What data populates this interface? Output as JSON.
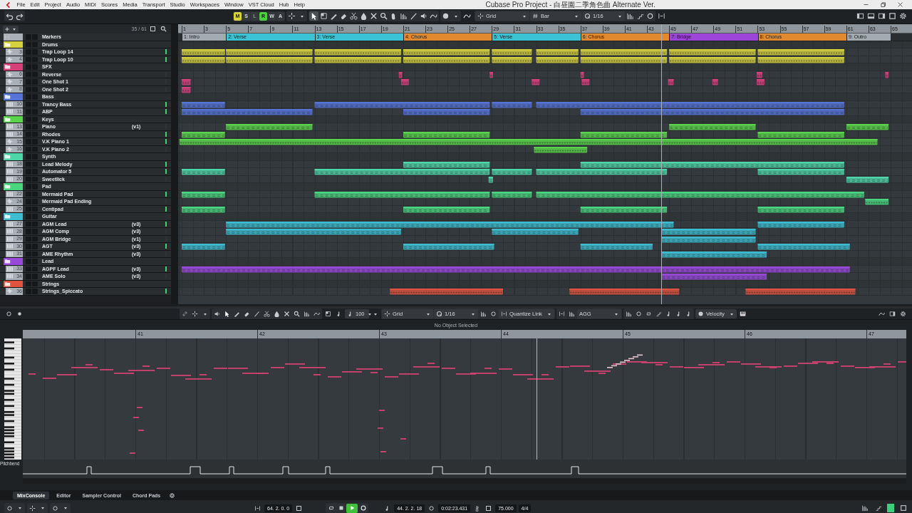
{
  "menu": [
    "File",
    "Edit",
    "Project",
    "Audio",
    "MIDI",
    "Scores",
    "Media",
    "Transport",
    "Studio",
    "Workspaces",
    "Window",
    "VST Cloud",
    "Hub",
    "Help"
  ],
  "window": {
    "title": "Cubase Pro Project - 白昼園二季角色曲 Alternate Ver."
  },
  "toolbar": {
    "modes": [
      {
        "label": "M",
        "kind": "mute",
        "on": true,
        "disabled": false
      },
      {
        "label": "S",
        "kind": "solo",
        "on": false,
        "disabled": false
      },
      {
        "label": "L",
        "kind": "listen",
        "on": false,
        "disabled": true
      },
      {
        "label": "R",
        "kind": "read",
        "on": true,
        "disabled": false
      },
      {
        "label": "W",
        "kind": "write",
        "on": false,
        "disabled": false
      },
      {
        "label": "A",
        "kind": "auto",
        "on": false,
        "disabled": false
      }
    ],
    "snap_type": "Grid",
    "grid_type": "Bar",
    "quantize": "1/16"
  },
  "project": {
    "track_count": "35 / 61",
    "marker_track": "Markers",
    "ruler": [
      "1",
      "3",
      "5",
      "7",
      "9",
      "11",
      "13",
      "15",
      "17",
      "19",
      "21",
      "23",
      "25",
      "27",
      "29",
      "31",
      "33",
      "35",
      "37",
      "39",
      "41",
      "43",
      "45",
      "47",
      "49",
      "51",
      "53",
      "55",
      "57",
      "59",
      "61",
      "63",
      "65"
    ],
    "markers": [
      {
        "label": "1: Intro",
        "color": "#a3abb2"
      },
      {
        "label": "2: Verse",
        "color": "#3cc3d3"
      },
      {
        "label": "3: Verse",
        "color": "#3cc3d3"
      },
      {
        "label": "4: Chorus",
        "color": "#e0892f"
      },
      {
        "label": "5: Verse",
        "color": "#3cc3d3"
      },
      {
        "label": "6: Chorus",
        "color": "#e0892f"
      },
      {
        "label": "7: Bridge",
        "color": "#9b46d8"
      },
      {
        "label": "8: Chorus",
        "color": "#e0892f"
      },
      {
        "label": "9: Outro",
        "color": "#a3abb2"
      }
    ],
    "folders": [
      {
        "name": "Drums",
        "color": "#d6d23e",
        "children": [
          {
            "name": "Trap Loop 14",
            "kind": "audio",
            "number": "3",
            "signal": true
          },
          {
            "name": "Trap Loop 10",
            "kind": "audio",
            "number": "4",
            "signal": true
          }
        ]
      },
      {
        "name": "SFX",
        "color": "#d8407a",
        "children": [
          {
            "name": "Reverse",
            "kind": "audio",
            "number": "6",
            "signal": false
          },
          {
            "name": "One Shot 1",
            "kind": "audio",
            "number": "7",
            "signal": false
          },
          {
            "name": "One Shot 2",
            "kind": "audio",
            "number": "8",
            "signal": false
          }
        ]
      },
      {
        "name": "Bass",
        "color": "#5673d8",
        "children": [
          {
            "name": "Trancy Bass",
            "kind": "instrument",
            "number": "10",
            "signal": true
          },
          {
            "name": "ABP",
            "kind": "instrument",
            "number": "11",
            "signal": true
          }
        ]
      },
      {
        "name": "Keys",
        "color": "#5ad44a",
        "children": [
          {
            "name": "Piano",
            "kind": "instrument",
            "number": "13",
            "version": "(v1)",
            "signal": false
          },
          {
            "name": "Rhodes",
            "kind": "instrument",
            "number": "14",
            "signal": true
          },
          {
            "name": "V.K Piano 1",
            "kind": "audio",
            "number": "15",
            "signal": true
          },
          {
            "name": "V.K Piano 2",
            "kind": "audio",
            "number": "16",
            "signal": false
          }
        ]
      },
      {
        "name": "Synth",
        "color": "#4ed6a8",
        "children": [
          {
            "name": "Lead Melody",
            "kind": "instrument",
            "number": "18",
            "signal": true
          },
          {
            "name": "Automator 5",
            "kind": "instrument",
            "number": "19",
            "signal": true
          },
          {
            "name": "Sweetlick",
            "kind": "instrument",
            "number": "20",
            "signal": false
          }
        ]
      },
      {
        "name": "Pad",
        "color": "#48d67e",
        "children": [
          {
            "name": "Mermaid Pad",
            "kind": "instrument",
            "number": "22",
            "signal": true
          },
          {
            "name": "Mermaid Pad Ending",
            "kind": "audio",
            "number": "24",
            "signal": false
          },
          {
            "name": "Centipad",
            "kind": "instrument",
            "number": "25",
            "signal": true
          }
        ]
      },
      {
        "name": "Guitar",
        "color": "#3cbdd0",
        "children": [
          {
            "name": "AGM Lead",
            "kind": "instrument",
            "number": "27",
            "version": "(v3)",
            "signal": true
          },
          {
            "name": "AGM Comp",
            "kind": "instrument",
            "number": "28",
            "version": "(v3)",
            "signal": false
          },
          {
            "name": "AGM Bridge",
            "kind": "instrument",
            "number": "29",
            "version": "(v1)",
            "signal": false
          },
          {
            "name": "AGT",
            "kind": "instrument",
            "number": "30",
            "version": "(v3)",
            "signal": true
          },
          {
            "name": "AME Rhythm",
            "kind": "instrument",
            "number": "31",
            "version": "(v3)",
            "signal": false
          }
        ]
      },
      {
        "name": "Lead",
        "color": "#9a48dc",
        "children": [
          {
            "name": "AGPF Lead",
            "kind": "instrument",
            "number": "33",
            "version": "(v3)",
            "signal": true
          },
          {
            "name": "AME Solo",
            "kind": "instrument",
            "number": "34",
            "version": "(v3)",
            "signal": false
          }
        ]
      },
      {
        "name": "Strings",
        "color": "#e0533f",
        "children": [
          {
            "name": "Strings_Spiccato",
            "kind": "audio",
            "number": "36",
            "signal": true
          }
        ]
      }
    ]
  },
  "editor": {
    "velocity": "100",
    "snap": "Grid",
    "quantize": "1/16",
    "quantize_link": "Quantize Link",
    "scale": "AGG",
    "lane": "Velocity",
    "status": "No Object Selected",
    "bars": [
      "41",
      "42",
      "43",
      "44",
      "45",
      "46",
      "47"
    ],
    "controller": "Pitchbend"
  },
  "bottom": {
    "tabs": [
      {
        "label": "MixConsole",
        "selected": true
      },
      {
        "label": "Editor",
        "selected": false
      },
      {
        "label": "Sampler Control",
        "selected": false
      },
      {
        "label": "Chord Pads",
        "selected": false
      }
    ],
    "transport": {
      "left_locator": "64. 2. 0. 0",
      "position": "44. 2. 2. 18",
      "time": "0:02:23.431",
      "tempo": "75.000",
      "signature": "4/4",
      "playing": true
    }
  }
}
